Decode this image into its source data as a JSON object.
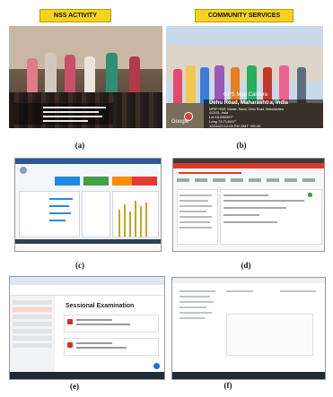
{
  "labels": {
    "nss_activity": "NSS ACTIVITY",
    "community_services": "COMMUNITY SERVICES"
  },
  "captions": {
    "a": "(a)",
    "b": "(b)",
    "c": "(c)",
    "d": "(d)",
    "e": "(e)",
    "f": "(f)"
  },
  "gps_overlay": {
    "app": "GPS Map Camera",
    "place": "Dehu Road, Maharashtra, India",
    "address": "MP9F+2WF, Kiwale, Raval, Dehu Road, Maharashtra",
    "pin": "412101, India",
    "lat": "Lat 18.669397°",
    "long": "Long 73.714507°",
    "datetime": "12/01/23 12:05 PM GMT +05:30",
    "brand": "Google"
  },
  "classroom": {
    "section_title": "Sessional Examination"
  },
  "colors": {
    "badge_yellow": "#f5d21c",
    "dashboard_blue": "#2b5797",
    "course_red": "#d93a2b",
    "classroom_active": "#fad2cf"
  }
}
